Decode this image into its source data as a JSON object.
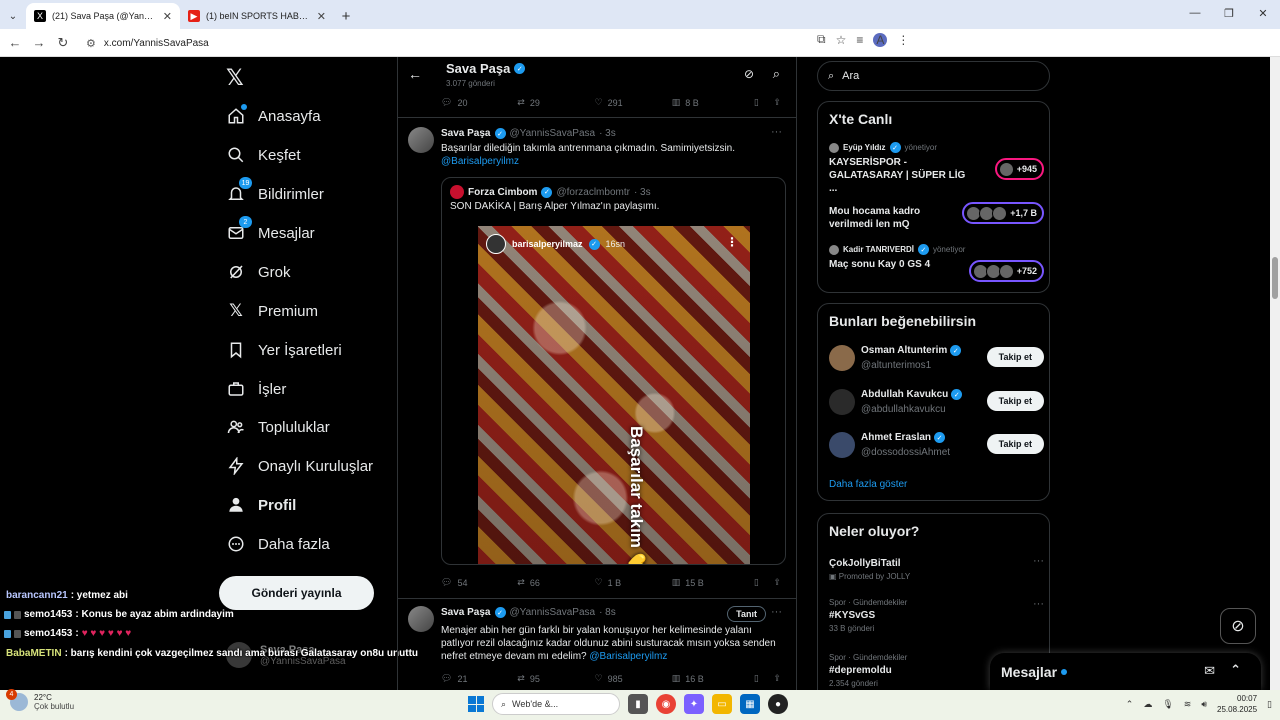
{
  "browser": {
    "tabs": [
      {
        "title": "(21) Sava Paşa (@YannisSavaPasa) / X",
        "active": true
      },
      {
        "title": "(1) beIN SPORTS HABER Canlı Yayın",
        "active": false
      }
    ],
    "url": "x.com/YannisSavaPasa",
    "profile_initial": "A"
  },
  "nav": {
    "items": [
      {
        "label": "Anasayfa",
        "icon": "home-icon"
      },
      {
        "label": "Keşfet",
        "icon": "search-icon"
      },
      {
        "label": "Bildirimler",
        "icon": "bell-icon",
        "badge": "19"
      },
      {
        "label": "Mesajlar",
        "icon": "mail-icon",
        "badge": "2"
      },
      {
        "label": "Grok",
        "icon": "grok-icon"
      },
      {
        "label": "Premium",
        "icon": "x-logo-icon"
      },
      {
        "label": "Yer İşaretleri",
        "icon": "bookmark-icon"
      },
      {
        "label": "İşler",
        "icon": "briefcase-icon"
      },
      {
        "label": "Topluluklar",
        "icon": "people-icon"
      },
      {
        "label": "Onaylı Kuruluşlar",
        "icon": "bolt-icon"
      },
      {
        "label": "Profil",
        "icon": "person-icon"
      },
      {
        "label": "Daha fazla",
        "icon": "more-circle-icon"
      }
    ],
    "post_button": "Gönderi yayınla",
    "account_name": "Sava Paşa",
    "account_handle": "@YannisSavaPasa"
  },
  "chat_overlay": [
    {
      "user": "barancann21",
      "msg": ": yetmez abi"
    },
    {
      "user": "semo1453",
      "msg": ": Konus be ayaz abim ardindayim"
    },
    {
      "user": "semo1453",
      "msg": ":",
      "hearts": "♥ ♥ ♥ ♥ ♥ ♥"
    },
    {
      "user": "BabaMETIN",
      "msg": ": barış kendini çok vazgeçilmez sandı ama burası Galatasaray on8u unuttu"
    }
  ],
  "feed": {
    "header_name": "Sava Paşa",
    "header_count": "3.077 gönderi",
    "top_actions": {
      "reply": "20",
      "retweet": "29",
      "like": "291",
      "views": "8 B"
    },
    "tweet1": {
      "name": "Sava Paşa",
      "handle": "@YannisSavaPasa",
      "time": "· 3s",
      "text": "Başarılar dilediğin takımla antrenmana çıkmadın. Samimiyetsizsin.",
      "mention": "@Barisalperyilmz",
      "quote": {
        "name": "Forza Cimbom",
        "handle": "@forzaclmbomtr",
        "time": "· 3s",
        "text": "SON DAKİKA | Barış Alper Yılmaz'ın paylaşımı.",
        "ig_user": "barisalperyilmaz",
        "ig_time": "16sn",
        "caption": "Başarılar takım 💛❤️"
      },
      "actions": {
        "reply": "54",
        "retweet": "66",
        "like": "1 B",
        "views": "15 B"
      }
    },
    "tweet2": {
      "name": "Sava Paşa",
      "handle": "@YannisSavaPasa",
      "time": "· 8s",
      "follow": "Tanıt",
      "text": "Menajer abin her gün farklı bir yalan konuşuyor her kelimesinde yalanı patlıyor rezil olacağınız kadar oldunuz abini susturacak mısın yoksa senden nefret etmeye devam mı edelim?",
      "mention": "@Barisalperyilmz",
      "actions": {
        "reply": "21",
        "retweet": "95",
        "like": "985",
        "views": "16 B"
      }
    }
  },
  "sidebar": {
    "search_placeholder": "Ara",
    "live": {
      "title": "X'te Canlı",
      "items": [
        {
          "host": "Eyüp Yıldız",
          "role": "yönetiyor",
          "title": "KAYSERİSPOR - GALATASARAY | SÜPER LİG ...",
          "count": "+945"
        },
        {
          "host": "",
          "role": "",
          "title": "Mou hocama kadro verilmedi len mQ",
          "count": "+1,7 B"
        },
        {
          "host": "Kadir TANRIVERDİ",
          "role": "yönetiyor",
          "title": "Maç sonu Kay 0 GS 4",
          "count": "+752"
        }
      ]
    },
    "suggest": {
      "title": "Bunları beğenebilirsin",
      "items": [
        {
          "name": "Osman Altunterim",
          "handle": "@altunterimos1",
          "button": "Takip et"
        },
        {
          "name": "Abdullah Kavukcu",
          "handle": "@abdullahkavukcu",
          "button": "Takip et"
        },
        {
          "name": "Ahmet Eraslan",
          "handle": "@dossodossiAhmet",
          "button": "Takip et"
        }
      ],
      "show_more": "Daha fazla göster"
    },
    "trends": {
      "title": "Neler oluyor?",
      "items": [
        {
          "category": "",
          "name": "ÇokJollyBiTatil",
          "posts": "Promoted by JOLLY"
        },
        {
          "category": "Spor · Gündemdekiler",
          "name": "#KYSvGS",
          "posts": "33 B gönderi"
        },
        {
          "category": "Spor · Gündemdekiler",
          "name": "#depremoldu",
          "posts": "2.354 gönderi"
        }
      ]
    }
  },
  "messages_bar": "Mesajlar",
  "taskbar": {
    "weather_temp": "22°C",
    "weather_desc": "Çok bulutlu",
    "weather_badge": "4",
    "search": "Web'de &...",
    "time": "00:07",
    "date": "25.08.2025"
  }
}
